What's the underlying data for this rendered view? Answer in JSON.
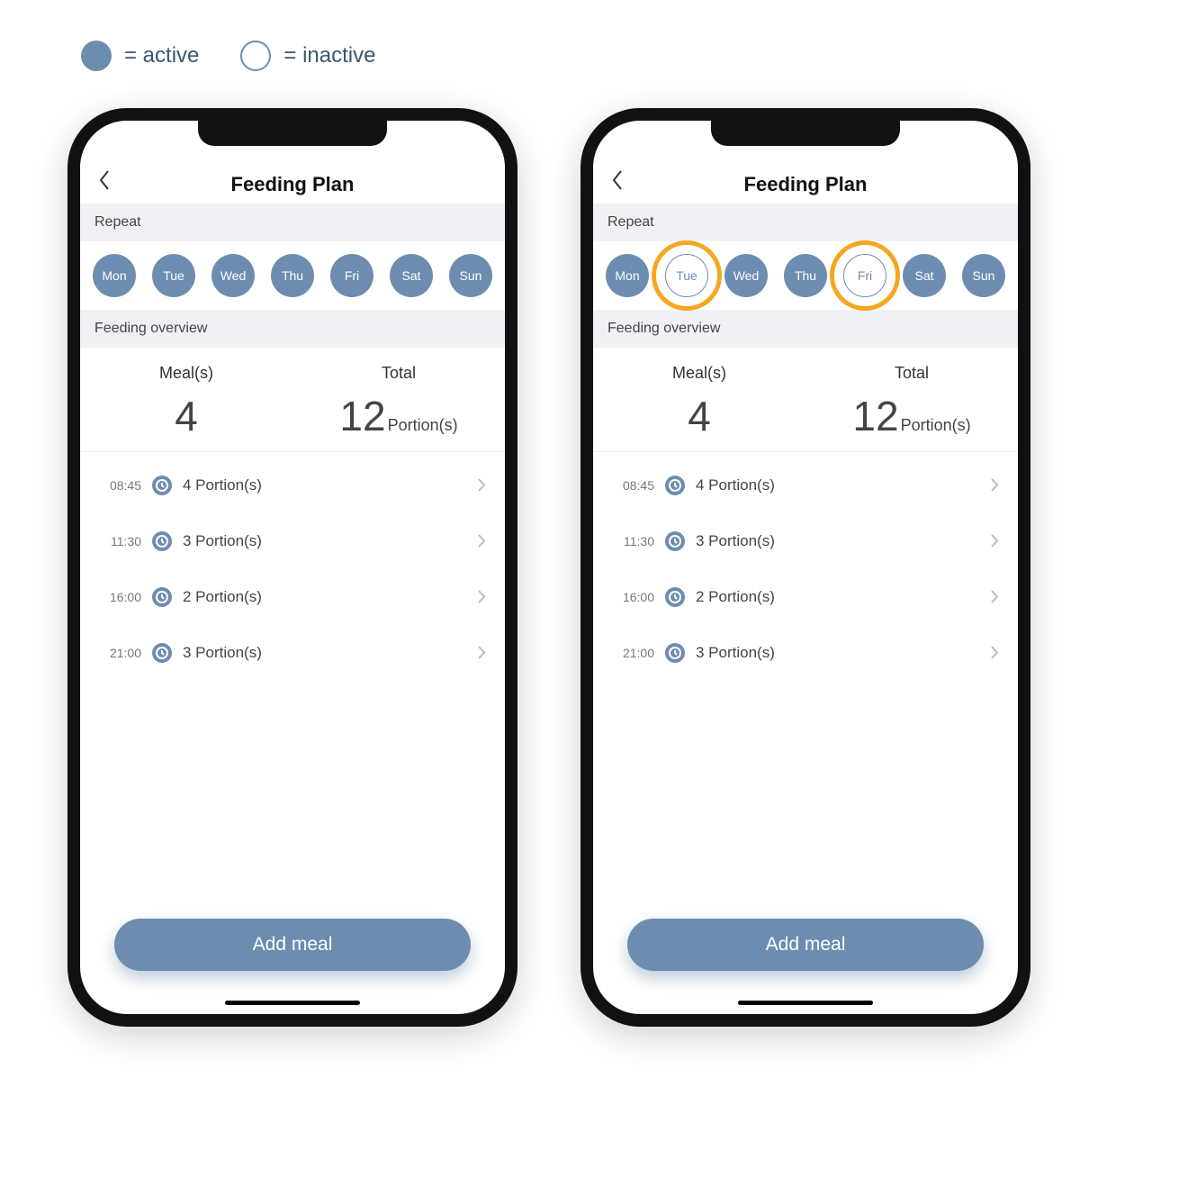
{
  "legend": {
    "active_label": "= active",
    "inactive_label": "= inactive"
  },
  "colors": {
    "accent": "#6d8db0",
    "highlight": "#f5a623"
  },
  "phones": [
    {
      "id": "left",
      "header_title": "Feeding Plan",
      "repeat_label": "Repeat",
      "days": [
        {
          "label": "Mon",
          "state": "active",
          "highlight": false
        },
        {
          "label": "Tue",
          "state": "active",
          "highlight": false
        },
        {
          "label": "Wed",
          "state": "active",
          "highlight": false
        },
        {
          "label": "Thu",
          "state": "active",
          "highlight": false
        },
        {
          "label": "Fri",
          "state": "active",
          "highlight": false
        },
        {
          "label": "Sat",
          "state": "active",
          "highlight": false
        },
        {
          "label": "Sun",
          "state": "active",
          "highlight": false
        }
      ],
      "overview_label": "Feeding overview",
      "meals_col_label": "Meal(s)",
      "total_col_label": "Total",
      "meals_count": "4",
      "total_value": "12",
      "total_unit": "Portion(s)",
      "meals": [
        {
          "time": "08:45",
          "text": "4 Portion(s)"
        },
        {
          "time": "11:30",
          "text": "3 Portion(s)"
        },
        {
          "time": "16:00",
          "text": "2 Portion(s)"
        },
        {
          "time": "21:00",
          "text": "3 Portion(s)"
        }
      ],
      "add_button": "Add meal"
    },
    {
      "id": "right",
      "header_title": "Feeding Plan",
      "repeat_label": "Repeat",
      "days": [
        {
          "label": "Mon",
          "state": "active",
          "highlight": false
        },
        {
          "label": "Tue",
          "state": "inactive",
          "highlight": true
        },
        {
          "label": "Wed",
          "state": "active",
          "highlight": false
        },
        {
          "label": "Thu",
          "state": "active",
          "highlight": false
        },
        {
          "label": "Fri",
          "state": "inactive",
          "highlight": true
        },
        {
          "label": "Sat",
          "state": "active",
          "highlight": false
        },
        {
          "label": "Sun",
          "state": "active",
          "highlight": false
        }
      ],
      "overview_label": "Feeding overview",
      "meals_col_label": "Meal(s)",
      "total_col_label": "Total",
      "meals_count": "4",
      "total_value": "12",
      "total_unit": "Portion(s)",
      "meals": [
        {
          "time": "08:45",
          "text": "4 Portion(s)"
        },
        {
          "time": "11:30",
          "text": "3 Portion(s)"
        },
        {
          "time": "16:00",
          "text": "2 Portion(s)"
        },
        {
          "time": "21:00",
          "text": "3 Portion(s)"
        }
      ],
      "add_button": "Add meal"
    }
  ]
}
